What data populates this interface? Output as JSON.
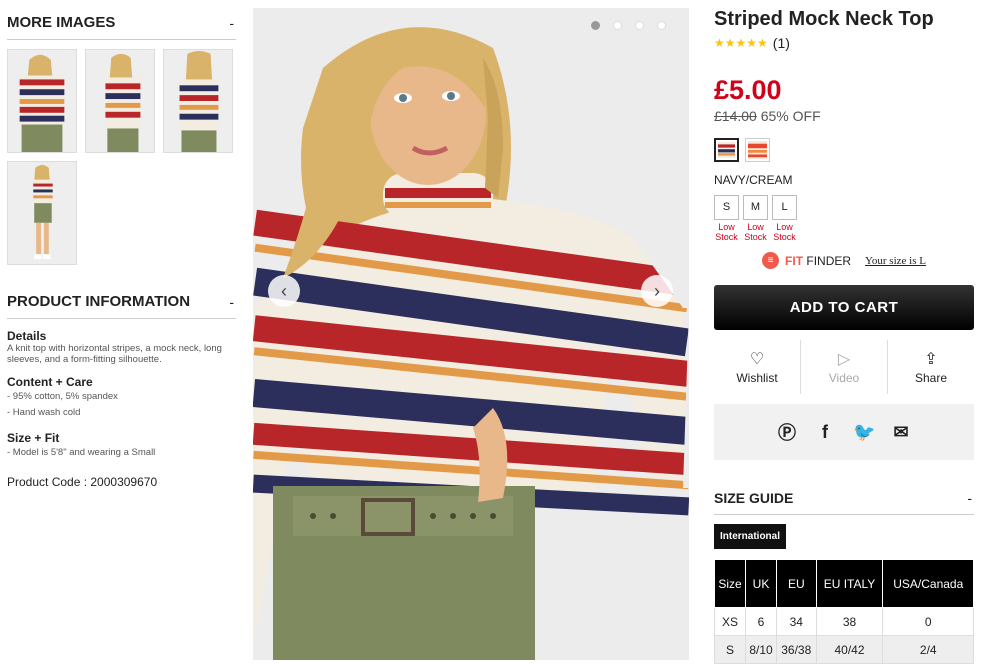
{
  "more_images": {
    "title": "MORE IMAGES",
    "toggle": "-"
  },
  "product_info": {
    "title": "PRODUCT INFORMATION",
    "toggle": "-",
    "details_label": "Details",
    "details_text": "A knit top with horizontal stripes, a mock neck, long sleeves, and a form-fitting silhouette.",
    "content_label": "Content + Care",
    "content_items": [
      "- 95% cotton, 5% spandex",
      "- Hand wash cold"
    ],
    "size_fit_label": "Size + Fit",
    "size_fit_items": [
      "- Model is 5'8\" and wearing a Small"
    ],
    "product_code": "Product Code : 2000309670"
  },
  "gallery": {
    "prev": "‹",
    "next": "›",
    "active_dot": 0,
    "dot_count": 4
  },
  "product": {
    "title": "Striped Mock Neck Top",
    "stars": "★★★★★",
    "review_count": "(1)",
    "price": "£5.00",
    "old_price": "£14.00",
    "discount": "65% OFF",
    "color_name": "NAVY/CREAM",
    "sizes": [
      {
        "label": "S",
        "stock": "Low Stock"
      },
      {
        "label": "M",
        "stock": "Low Stock"
      },
      {
        "label": "L",
        "stock": "Low Stock"
      }
    ],
    "fit_finder_bold": "FIT",
    "fit_finder_rest": "FINDER",
    "fit_finder_size": "Your size is L",
    "add_to_cart": "ADD TO CART",
    "wishlist": "Wishlist",
    "video": "Video",
    "share": "Share"
  },
  "size_guide": {
    "title": "SIZE GUIDE",
    "toggle": "-",
    "tab": "International",
    "headers": [
      "Size",
      "UK",
      "EU",
      "EU ITALY",
      "USA/Canada"
    ],
    "rows": [
      [
        "XS",
        "6",
        "34",
        "38",
        "0"
      ],
      [
        "S",
        "8/10",
        "36/38",
        "40/42",
        "2/4"
      ]
    ]
  },
  "colors": {
    "price": "#d0021b",
    "accent": "#f15a4a",
    "navy": "#2c2f5b",
    "red": "#b8262a",
    "mustard": "#e39a48",
    "cream": "#f3ece0",
    "olive": "#7f8a5e"
  }
}
